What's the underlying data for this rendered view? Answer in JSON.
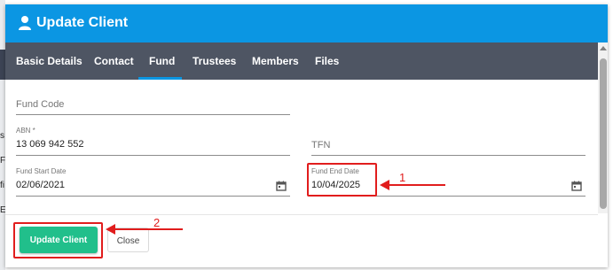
{
  "background": {
    "partial_chars": "s\nF(\nfi\nE"
  },
  "dialog": {
    "title": "Update Client",
    "title_icon": "person-icon",
    "header_color": "#0b96e3",
    "tab_bar_color": "#4e5563"
  },
  "tabs": [
    {
      "label": "Basic Details",
      "active": false
    },
    {
      "label": "Contact",
      "active": false
    },
    {
      "label": "Fund",
      "active": true
    },
    {
      "label": "Trustees",
      "active": false
    },
    {
      "label": "Members",
      "active": false
    },
    {
      "label": "Files",
      "active": false
    }
  ],
  "form": {
    "fund_code": {
      "placeholder": "Fund Code",
      "value": ""
    },
    "abn": {
      "label": "ABN *",
      "value": "13 069 942 552"
    },
    "tfn": {
      "placeholder": "TFN",
      "value": ""
    },
    "fund_start_date": {
      "label": "Fund Start Date",
      "value": "02/06/2021",
      "icon": "calendar-icon"
    },
    "fund_end_date": {
      "label": "Fund End Date",
      "value": "10/04/2025",
      "icon": "calendar-icon"
    }
  },
  "footer": {
    "update_label": "Update Client",
    "close_label": "Close",
    "update_color": "#21bf8b"
  },
  "annotations": [
    {
      "number": "1",
      "target": "fund-end-date",
      "color": "#e11d1d"
    },
    {
      "number": "2",
      "target": "update-client-button",
      "color": "#e11d1d"
    }
  ]
}
